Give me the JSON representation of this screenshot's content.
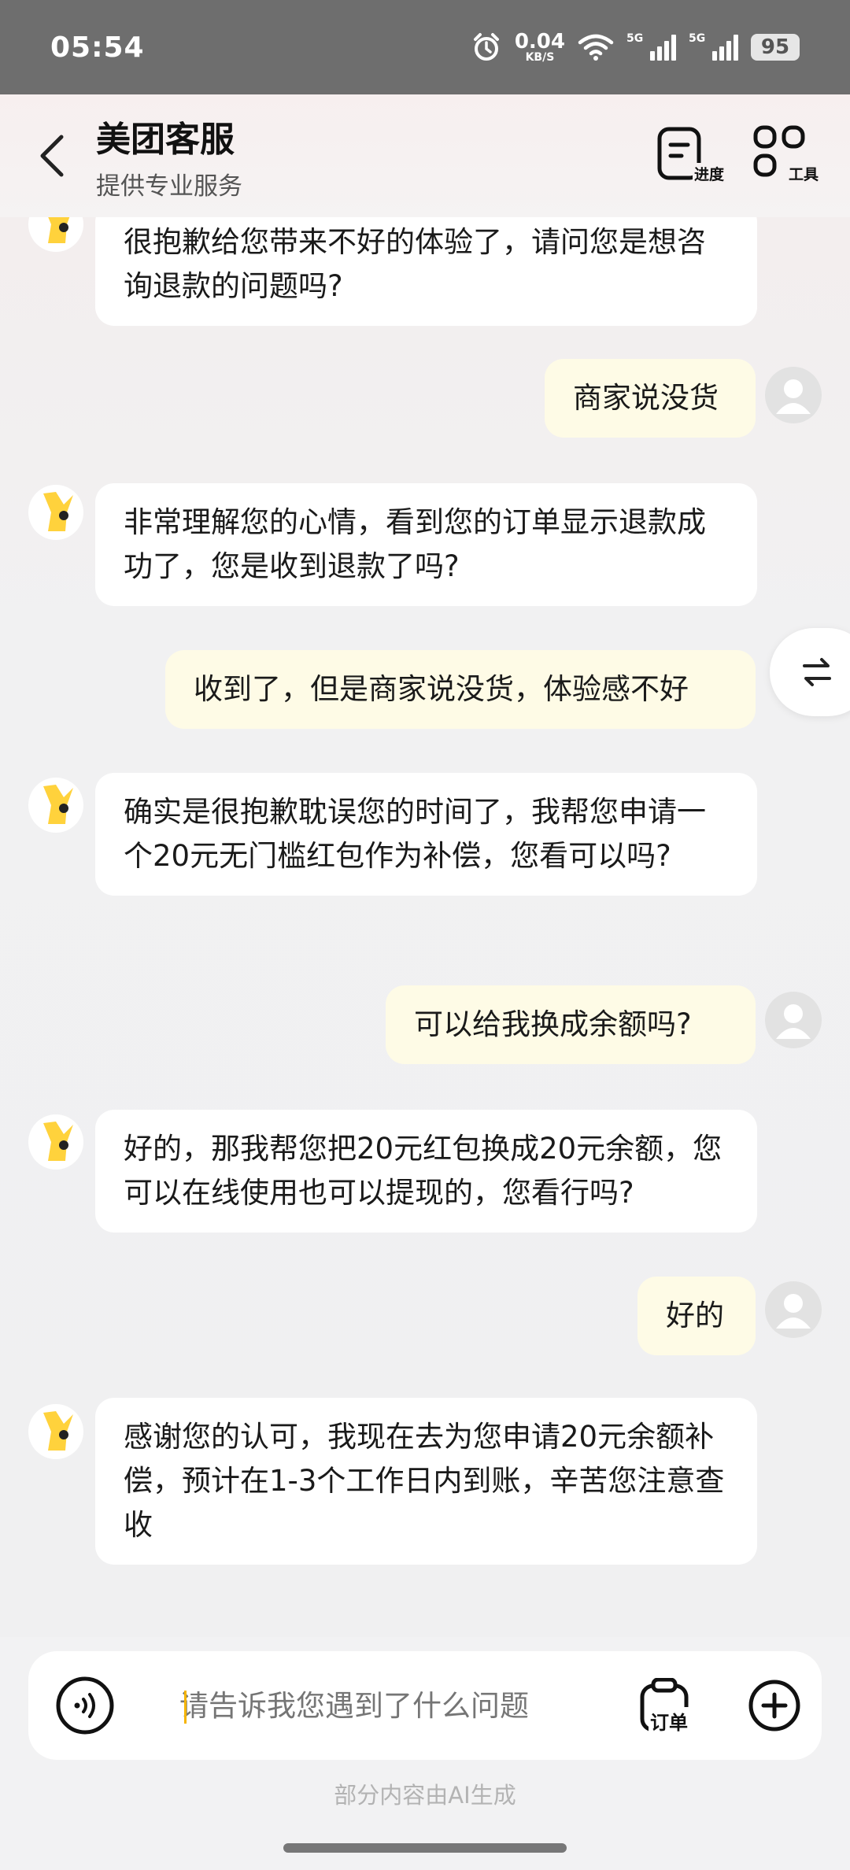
{
  "status_bar": {
    "time": "05:54",
    "net_speed_value": "0.04",
    "net_speed_unit": "KB/S",
    "signal1_label": "5G",
    "signal2_label": "5G",
    "battery": "95",
    "icons": [
      "alarm-icon",
      "wifi-icon",
      "signal-icon",
      "signal-icon"
    ]
  },
  "header": {
    "title": "美团客服",
    "subtitle": "提供专业服务",
    "progress_label": "进度",
    "tools_label": "工具"
  },
  "messages": [
    {
      "from": "bot",
      "text": "很抱歉给您带来不好的体验了，请问您是想咨询退款的问题吗?"
    },
    {
      "from": "user",
      "text": "商家说没货"
    },
    {
      "from": "bot",
      "text": "非常理解您的心情，看到您的订单显示退款成功了，您是收到退款了吗?"
    },
    {
      "from": "user",
      "text": "收到了，但是商家说没货，体验感不好"
    },
    {
      "from": "bot",
      "text": "确实是很抱歉耽误您的时间了，我帮您申请一个20元无门槛红包作为补偿，您看可以吗?"
    },
    {
      "from": "user",
      "text": "可以给我换成余额吗?"
    },
    {
      "from": "bot",
      "text": "好的，那我帮您把20元红包换成20元余额，您可以在线使用也可以提现的，您看行吗?"
    },
    {
      "from": "user",
      "text": "好的"
    },
    {
      "from": "bot",
      "text": "感谢您的认可，我现在去为您申请20元余额补偿，预计在1-3个工作日内到账，辛苦您注意查收"
    }
  ],
  "input": {
    "placeholder": "请告诉我您遇到了什么问题",
    "order_label": "订单"
  },
  "footer": {
    "ai_note": "部分内容由AI生成"
  },
  "colors": {
    "bot_bubble": "#ffffff",
    "user_bubble": "#fefbe6",
    "accent": "#f5b400"
  }
}
